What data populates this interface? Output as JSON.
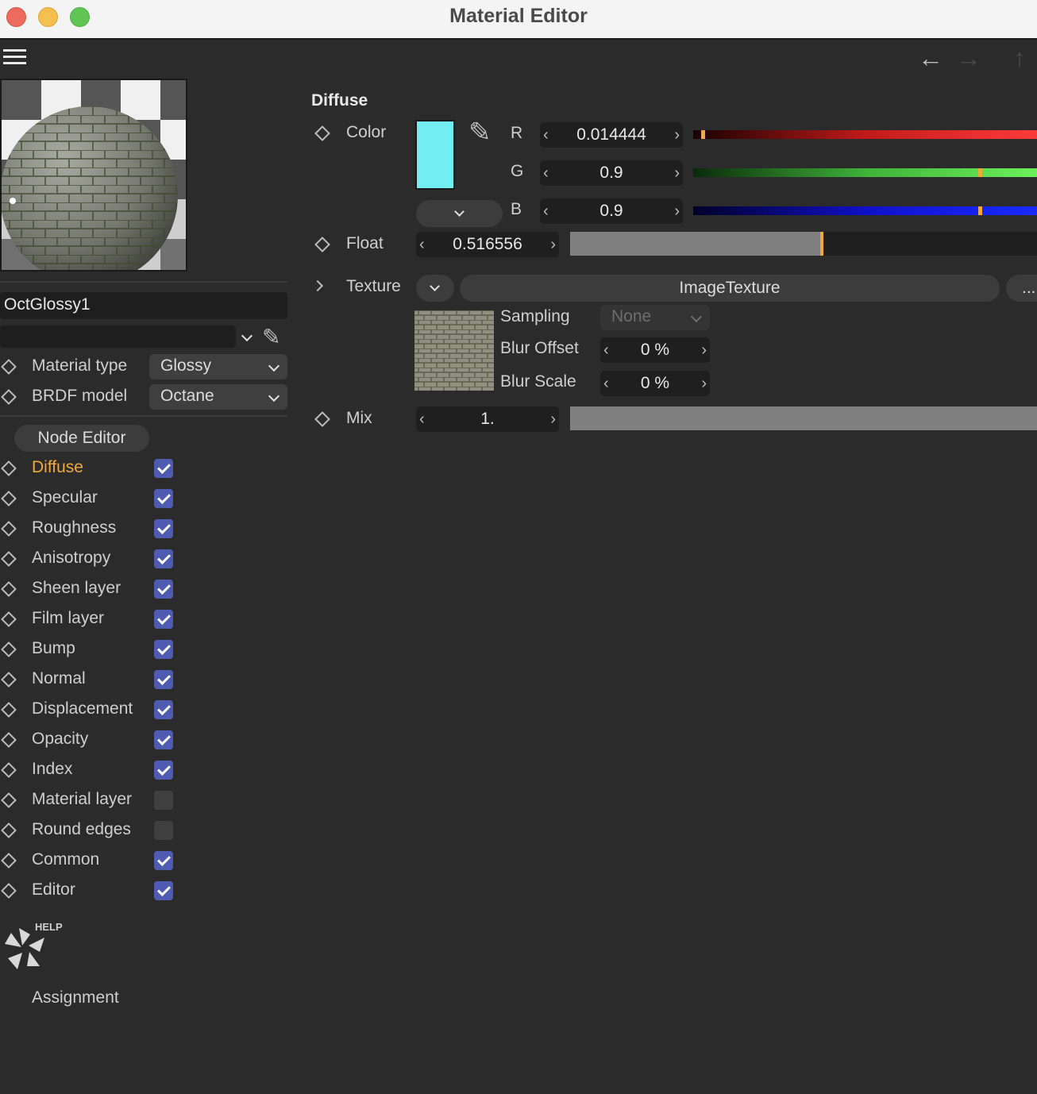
{
  "window": {
    "title": "Material Editor"
  },
  "material": {
    "name": "OctGlossy1",
    "sub_value": "",
    "material_type_label": "Material type",
    "material_type_value": "Glossy",
    "brdf_label": "BRDF model",
    "brdf_value": "Octane"
  },
  "sidebar": {
    "node_editor_label": "Node Editor",
    "channels": [
      {
        "label": "Diffuse",
        "checked": true,
        "active": true
      },
      {
        "label": "Specular",
        "checked": true
      },
      {
        "label": "Roughness",
        "checked": true
      },
      {
        "label": "Anisotropy",
        "checked": true
      },
      {
        "label": "Sheen layer",
        "checked": true
      },
      {
        "label": "Film layer",
        "checked": true
      },
      {
        "label": "Bump",
        "checked": true
      },
      {
        "label": "Normal",
        "checked": true
      },
      {
        "label": "Displacement",
        "checked": true
      },
      {
        "label": "Opacity",
        "checked": true
      },
      {
        "label": "Index",
        "checked": true
      },
      {
        "label": "Material layer",
        "checked": false
      },
      {
        "label": "Round edges",
        "checked": false
      },
      {
        "label": "Common",
        "checked": true
      },
      {
        "label": "Editor",
        "checked": true
      }
    ],
    "help_label": "HELP",
    "assignment_label": "Assignment"
  },
  "diffuse": {
    "section_title": "Diffuse",
    "color_label": "Color",
    "swatch_color": "#72eef2",
    "r_label": "R",
    "r_value": "0.014444",
    "g_label": "G",
    "g_value": "0.9",
    "b_label": "B",
    "b_value": "0.9",
    "r_level": 0.014444,
    "g_level": 0.9,
    "b_level": 0.9,
    "float_label": "Float",
    "float_value": "0.516556",
    "float_level": 0.516556,
    "texture_label": "Texture",
    "texture_button": "ImageTexture",
    "texture_more": "...",
    "sampling_label": "Sampling",
    "sampling_value": "None",
    "blur_offset_label": "Blur Offset",
    "blur_offset_value": "0 %",
    "blur_scale_label": "Blur Scale",
    "blur_scale_value": "0 %",
    "mix_label": "Mix",
    "mix_value": "1.",
    "mix_level": 1.0
  },
  "colors": {
    "accent_orange": "#f1a93a",
    "checkbox_blue": "#4d5bb0",
    "background": "#2b2b2b"
  }
}
